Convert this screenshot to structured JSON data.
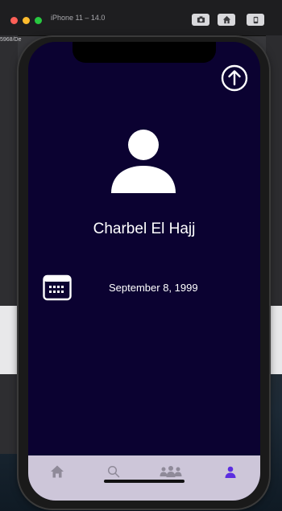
{
  "simulator": {
    "title": "iPhone 11 – 14.0",
    "background_text": "5968/De"
  },
  "profile": {
    "name": "Charbel El Hajj",
    "birth_date": "September 8, 1999"
  },
  "icons": {
    "upload": "upload-icon",
    "avatar": "person-icon",
    "calendar": "calendar-icon"
  },
  "tabs": [
    {
      "name": "home",
      "icon": "home-icon",
      "active": false
    },
    {
      "name": "search",
      "icon": "search-icon",
      "active": false
    },
    {
      "name": "group",
      "icon": "group-icon",
      "active": false
    },
    {
      "name": "profile",
      "icon": "person-icon",
      "active": true
    }
  ],
  "colors": {
    "screen_background": "#0b0231",
    "tab_bar": "#cdc6d9",
    "tab_active": "#5b2de0",
    "tab_inactive": "#8f8a99",
    "text": "#ffffff"
  }
}
